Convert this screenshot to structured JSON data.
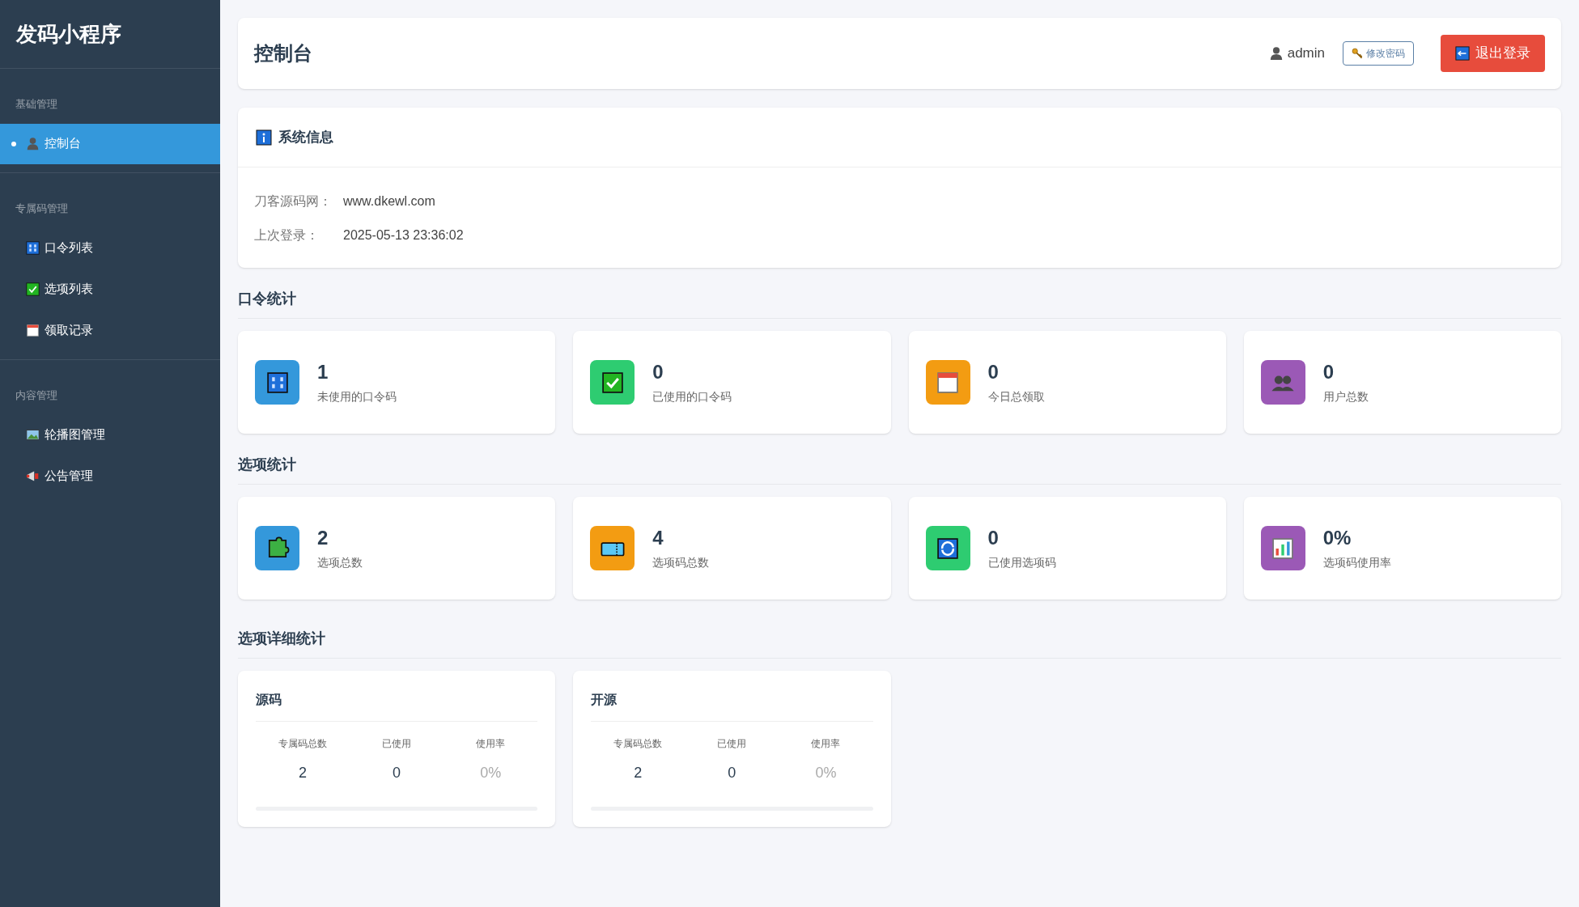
{
  "sidebar": {
    "title": "发码小程序",
    "sections": [
      {
        "label": "基础管理",
        "items": [
          {
            "label": "控制台",
            "selected": true
          }
        ]
      },
      {
        "label": "专属码管理",
        "items": [
          {
            "label": "口令列表",
            "selected": false
          },
          {
            "label": "选项列表",
            "selected": false
          },
          {
            "label": "领取记录",
            "selected": false
          }
        ]
      },
      {
        "label": "内容管理",
        "items": [
          {
            "label": "轮播图管理",
            "selected": false
          },
          {
            "label": "公告管理",
            "selected": false
          }
        ]
      }
    ]
  },
  "header": {
    "title": "控制台",
    "user": "admin",
    "change_password": "修改密码",
    "logout": "退出登录"
  },
  "system_info": {
    "title": "系统信息",
    "rows": [
      {
        "label": "刀客源码网：",
        "value": "www.dkewl.com"
      },
      {
        "label": "上次登录：",
        "value": "2025-05-13 23:36:02"
      }
    ]
  },
  "code_stats": {
    "title": "口令统计",
    "cards": [
      {
        "value": "1",
        "label": "未使用的口令码",
        "color": "#3498db"
      },
      {
        "value": "0",
        "label": "已使用的口令码",
        "color": "#2ecc71"
      },
      {
        "value": "0",
        "label": "今日总领取",
        "color": "#f39c12"
      },
      {
        "value": "0",
        "label": "用户总数",
        "color": "#9b59b6"
      }
    ]
  },
  "option_stats": {
    "title": "选项统计",
    "cards": [
      {
        "value": "2",
        "label": "选项总数",
        "color": "#3498db"
      },
      {
        "value": "4",
        "label": "选项码总数",
        "color": "#f39c12"
      },
      {
        "value": "0",
        "label": "已使用选项码",
        "color": "#2ecc71"
      },
      {
        "value": "0%",
        "label": "选项码使用率",
        "color": "#9b59b6"
      }
    ]
  },
  "detail_stats": {
    "title": "选项详细统计",
    "cards": [
      {
        "title": "源码",
        "columns": [
          {
            "label": "专属码总数",
            "value": "2"
          },
          {
            "label": "已使用",
            "value": "0"
          },
          {
            "label": "使用率",
            "value": "0%"
          }
        ],
        "level": 0
      },
      {
        "title": "开源",
        "columns": [
          {
            "label": "专属码总数",
            "value": "2"
          },
          {
            "label": "已使用",
            "value": "0"
          },
          {
            "label": "使用率",
            "value": "0%"
          }
        ],
        "level": 0
      }
    ]
  }
}
